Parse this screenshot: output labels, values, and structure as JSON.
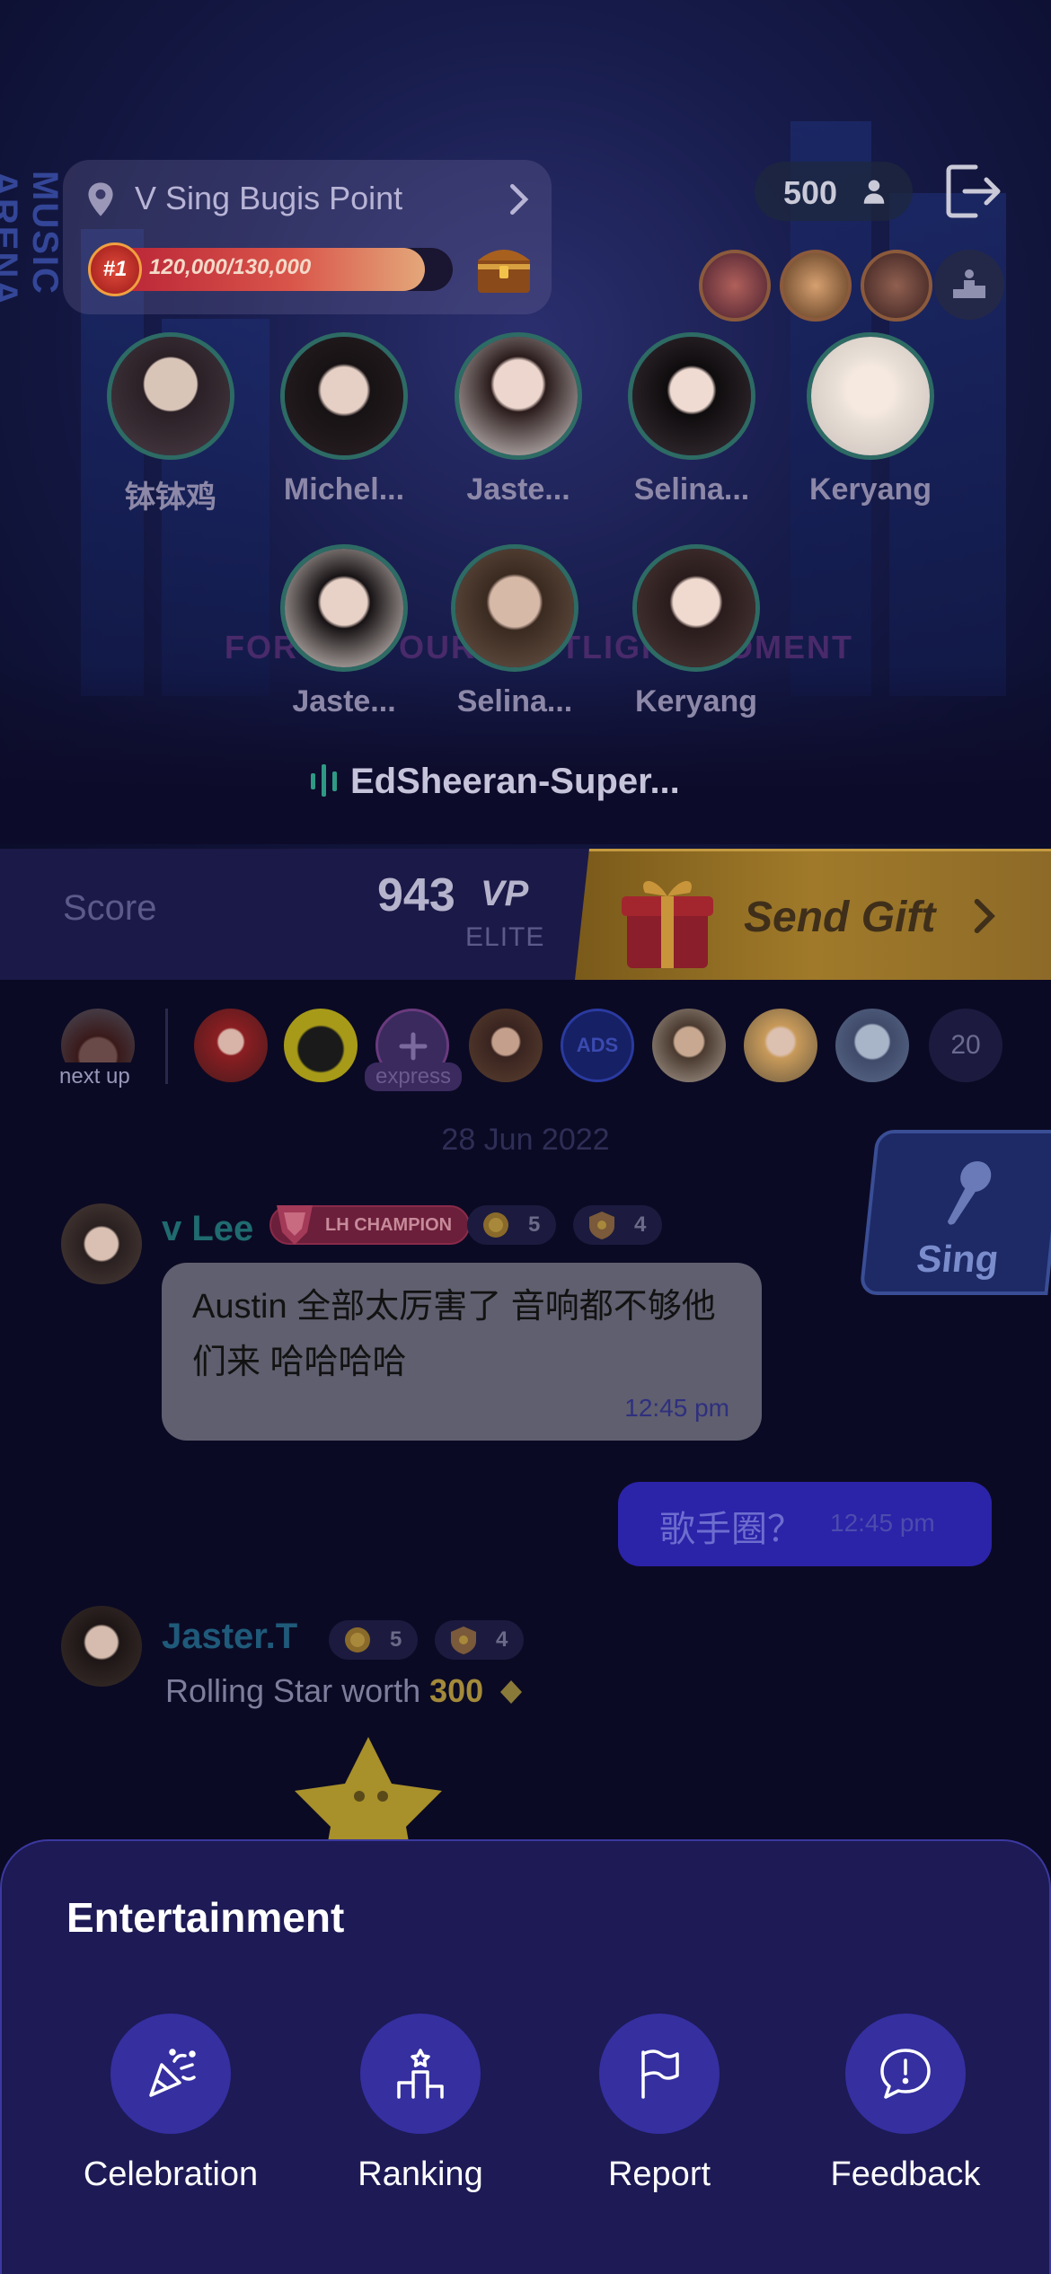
{
  "stage": {
    "neon_sign": "MUSIC ARENA",
    "banner": "FORGING OUR SPOTLIGHT MOMENT",
    "location": "V Sing Bugis Point",
    "rank": "#1",
    "progress_text": "120,000/130,000",
    "progress_fraction": 0.923,
    "audience_count": "500",
    "singers_row1": [
      "钵钵鸡",
      "Michel...",
      "Jaste...",
      "Selina...",
      "Keryang"
    ],
    "singers_row2": [
      "Jaste...",
      "Selina...",
      "Keryang"
    ],
    "now_playing": "EdSheeran-Super..."
  },
  "score": {
    "label": "Score",
    "value": "943",
    "unit": "VP",
    "tier": "ELITE",
    "send_gift_label": "Send Gift"
  },
  "audience": {
    "next_up_label": "next up",
    "express_label": "express",
    "ads_label": "ADS",
    "more_count": "20"
  },
  "chat": {
    "date": "28 Jun 2022",
    "sing_label": "Sing",
    "messages": [
      {
        "user": "v Lee",
        "badge": "LH CHAMPION",
        "level_a": "5",
        "level_b": "4",
        "text": "Austin 全部太厉害了 音响都不够他们来 哈哈哈哈",
        "time": "12:45 pm"
      },
      {
        "text": "歌手圈？",
        "time": "12:45 pm"
      },
      {
        "user": "Jaster.T",
        "level_a": "5",
        "level_b": "4",
        "gift_prefix": "Rolling Star worth ",
        "gift_amount": "300"
      }
    ]
  },
  "sheet": {
    "title": "Entertainment",
    "actions": [
      {
        "label": "Celebration",
        "icon": "party-popper-icon"
      },
      {
        "label": "Ranking",
        "icon": "podium-icon"
      },
      {
        "label": "Report",
        "icon": "flag-icon"
      },
      {
        "label": "Feedback",
        "icon": "alert-bubble-icon"
      }
    ]
  },
  "colors": {
    "sheet_bg": "#1d1a55",
    "action_circle": "#352fa0",
    "gift_gold": "#a07a2a",
    "username_teal": "#1f6b6f"
  }
}
